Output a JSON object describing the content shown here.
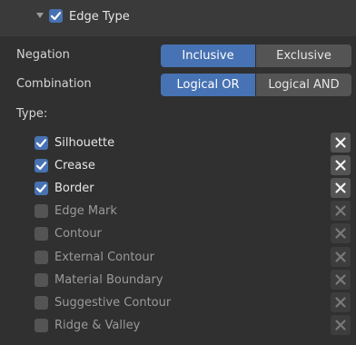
{
  "header": {
    "title": "Edge Type",
    "checked": true
  },
  "negation": {
    "label": "Negation",
    "options": [
      "Inclusive",
      "Exclusive"
    ],
    "selected": "Inclusive"
  },
  "combination": {
    "label": "Combination",
    "options": [
      "Logical OR",
      "Logical AND"
    ],
    "selected": "Logical OR"
  },
  "type_label": "Type:",
  "types": [
    {
      "label": "Silhouette",
      "checked": true
    },
    {
      "label": "Crease",
      "checked": true
    },
    {
      "label": "Border",
      "checked": true
    },
    {
      "label": "Edge Mark",
      "checked": false
    },
    {
      "label": "Contour",
      "checked": false
    },
    {
      "label": "External Contour",
      "checked": false
    },
    {
      "label": "Material Boundary",
      "checked": false
    },
    {
      "label": "Suggestive Contour",
      "checked": false
    },
    {
      "label": "Ridge & Valley",
      "checked": false
    }
  ],
  "colors": {
    "accent": "#4772b3",
    "panel": "#303030",
    "header": "#3a3a3a"
  },
  "icons": {
    "exclude": "x-icon",
    "disclosure": "chevron-down-icon",
    "check": "checkmark-icon"
  }
}
